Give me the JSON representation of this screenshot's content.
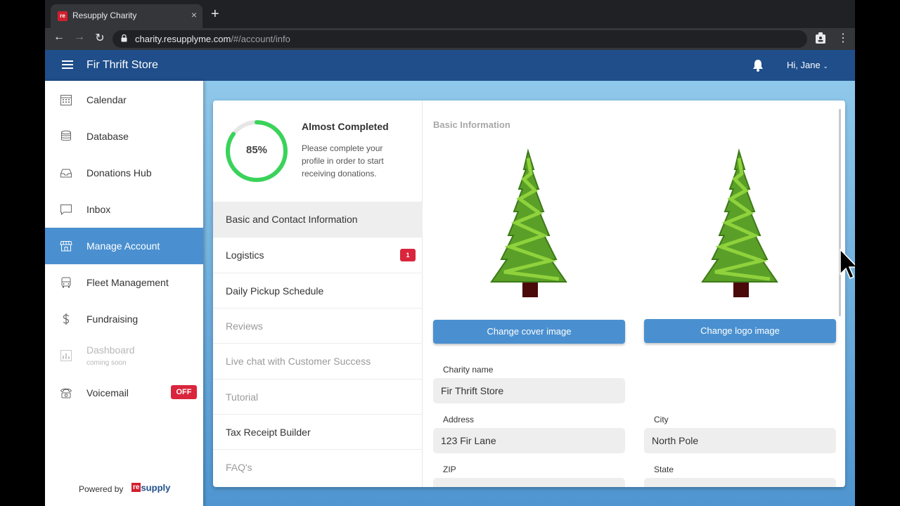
{
  "browser": {
    "tab_title": "Resupply Charity",
    "tab_favicon": "re",
    "tab_close": "×",
    "new_tab": "+",
    "url_host": "charity.resupplyme.com",
    "url_path": "/#/account/info"
  },
  "header": {
    "title": "Fir Thrift Store",
    "greeting": "Hi, Jane"
  },
  "sidebar": {
    "items": [
      {
        "label": "Calendar",
        "icon": "calendar-icon"
      },
      {
        "label": "Database",
        "icon": "database-icon"
      },
      {
        "label": "Donations Hub",
        "icon": "inbox-tray-icon"
      },
      {
        "label": "Inbox",
        "icon": "chat-bubble-icon"
      },
      {
        "label": "Manage Account",
        "icon": "storefront-icon"
      },
      {
        "label": "Fleet Management",
        "icon": "truck-icon"
      },
      {
        "label": "Fundraising",
        "icon": "dollar-icon"
      },
      {
        "label": "Dashboard",
        "sub": "coming soon",
        "icon": "bar-chart-icon"
      },
      {
        "label": "Voicemail",
        "badge": "OFF",
        "icon": "telephone-icon"
      }
    ],
    "powered_by": "Powered by",
    "logo_re": "re",
    "logo_supply": "supply"
  },
  "progress": {
    "percent_label": "85%",
    "percent_value": 0.85,
    "title": "Almost Completed",
    "description": "Please complete your profile in order to start receiving donations."
  },
  "account_menu": {
    "items": [
      {
        "label": "Basic and Contact Information"
      },
      {
        "label": "Logistics",
        "badge": "1"
      },
      {
        "label": "Daily Pickup Schedule"
      },
      {
        "label": "Reviews"
      },
      {
        "label": "Live chat with Customer Success"
      },
      {
        "label": "Tutorial"
      },
      {
        "label": "Tax Receipt Builder"
      },
      {
        "label": "FAQ's"
      }
    ]
  },
  "basic_info": {
    "section_title": "Basic Information",
    "change_cover_label": "Change cover image",
    "change_logo_label": "Change logo image",
    "charity_name_label": "Charity name",
    "charity_name_value": "Fir Thrift Store",
    "address_label": "Address",
    "address_value": "123 Fir Lane",
    "city_label": "City",
    "city_value": "North Pole",
    "zip_label": "ZIP",
    "state_label": "State"
  },
  "colors": {
    "header_blue": "#1f4e8a",
    "accent_blue": "#4a90d0",
    "badge_red": "#d9263c",
    "progress_green": "#3ad35a"
  }
}
